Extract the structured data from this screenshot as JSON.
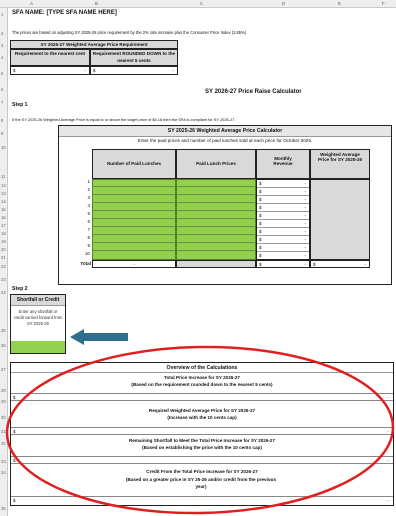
{
  "columns": [
    "A",
    "B",
    "C",
    "D",
    "E",
    "F"
  ],
  "rows": [
    "1",
    "2",
    "3",
    "4",
    "5",
    "6",
    "7",
    "8",
    "9",
    "10",
    "11",
    "12",
    "13",
    "14",
    "15",
    "16",
    "17",
    "18",
    "19",
    "20",
    "21",
    "22",
    "23",
    "24",
    "25",
    "26",
    "27",
    "28",
    "29",
    "30",
    "31",
    "32",
    "33",
    "34",
    "35"
  ],
  "sfa_name": "SFA NAME: [TYPE SFA NAME HERE]",
  "intro": "The prices are based on adjusting SY 2025-26 price requirement by the 2% rate increase plus the Consumer Price Index (3.85%).",
  "req_table": {
    "title": "SY 2026-27 Weighted Average Price Requirement",
    "col1": "Requirement to the nearest cent",
    "col2": "Requirement ROUNDED DOWN to the nearest 5 cents",
    "val1": "$",
    "dash1": "-",
    "val2": "$",
    "dash2": "-"
  },
  "calc_title": "SY 2026-27 Price Raise Calculator",
  "step1": {
    "label": "Step 1",
    "desc": "If the SY 2025-26 Weighted Average Price is equal to or above the target price of $4.16 then the SFA is compliant for SY 2026-27.",
    "box_title": "SY 2025-26 Weighted Average Price Calculator",
    "instruction": "Enter the paid prices and number of paid lunches sold at each price for October 2025.",
    "headers": {
      "lunches": "Number of Paid Lunches",
      "prices": "Paid Lunch Prices",
      "revenue": "Monthly Revenue",
      "weighted": "Weighted Average Price for SY 2025-26"
    },
    "row_numbers": [
      "1",
      "2",
      "3",
      "4",
      "5",
      "6",
      "7",
      "8",
      "9",
      "10"
    ],
    "currency": "$",
    "dash": "-",
    "total_label": "Total",
    "total_lunches": "-",
    "total_revenue_cur": "$",
    "total_revenue": "-",
    "wap_cur": "$",
    "wap": "-"
  },
  "step2": {
    "label": "Step 2",
    "box_title": "Shortfall or Credit",
    "box_desc": "Enter any shortfall or credit carried forward from SY 2025-26"
  },
  "overview": {
    "title": "Overview of the Calculations",
    "items": [
      {
        "title": "Total Price Increase for SY 2026-27",
        "sub": "(Based on the requirement rounded down to the nearest 5 cents)",
        "cur": "$",
        "val": "-"
      },
      {
        "title": "Required Weighted Average Price for SY 2026-27",
        "sub": "(Increase with the 10 cents cap)",
        "cur": "$",
        "val": "-"
      },
      {
        "title": "Remaining Shortfall to Meet the Total Price Increase for SY 2026-27",
        "sub": "(Based on establishing the price with the 10 cents cap)",
        "cur": "$",
        "val": "-"
      },
      {
        "title": "Credit From the Total Price Increase for SY 2026-27",
        "sub": "(Based on a greater price in SY 25-26 and/or credit from the previous year)",
        "cur": "$",
        "val": "-"
      }
    ]
  },
  "colors": {
    "green": "#92d050",
    "arrow": "#2e6f8e",
    "circle": "#e02020"
  },
  "icons": {
    "arrow": "left-arrow-icon"
  }
}
